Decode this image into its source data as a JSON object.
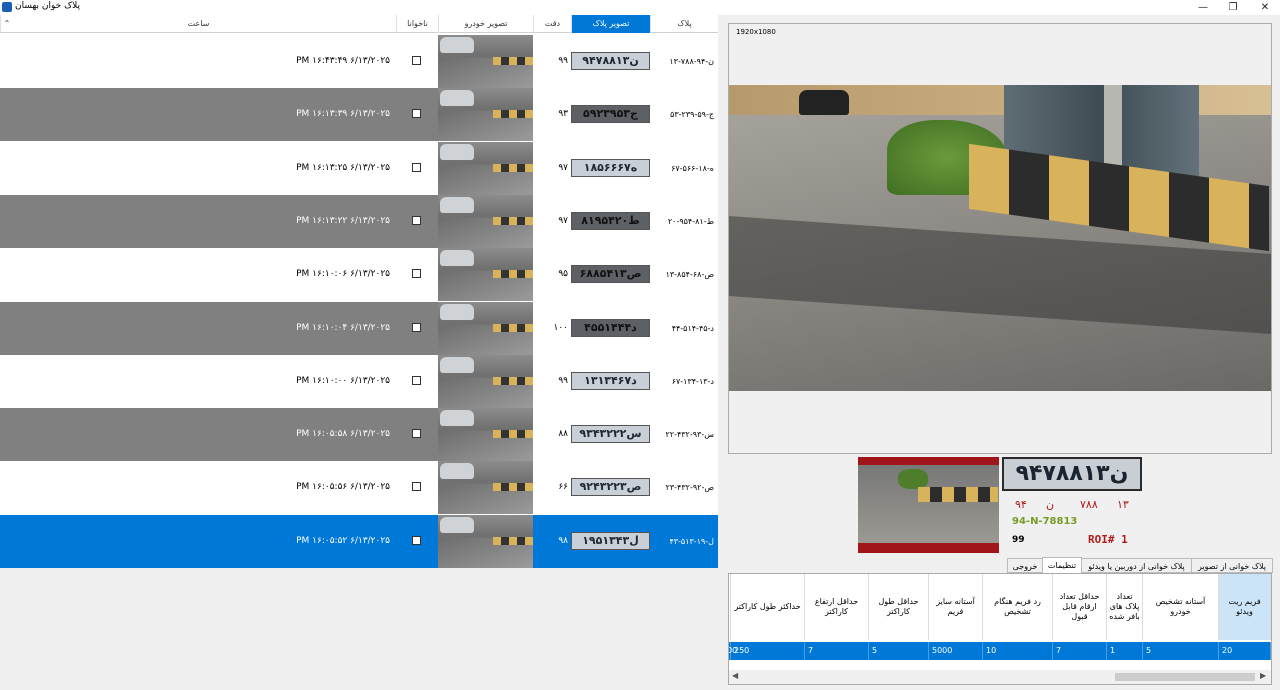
{
  "window": {
    "title": "پلاک خوان بهسان",
    "min": "—",
    "max": "❐",
    "close": "✕"
  },
  "grid": {
    "columns": [
      "پلاک",
      "تصویر پلاک",
      "دقت",
      "تصویر خودرو",
      "ناخوانا",
      "ساعت"
    ],
    "sort_marker": "⌃",
    "rows": [
      {
        "plate_text": "۱۳-۷۸۸-ن-۹۴",
        "plate_img": "۹۴ن۷۸۸۱۳",
        "accuracy": "۹۹",
        "time": "PM ۱۶:۴۳:۴۹ ۶/۱۳/۲۰۲۵",
        "style": "white"
      },
      {
        "plate_text": "۵۳-۲۳۹-ج-۵۹",
        "plate_img": "۵۹ج۲۳۹۵۳",
        "accuracy": "۹۳",
        "time": "PM ۱۶:۱۳:۳۹ ۶/۱۳/۲۰۲۵",
        "style": "gray"
      },
      {
        "plate_text": "۶۷-۵۶۶-ه-۱۸",
        "plate_img": "۱۸ه۵۶۶۶۷",
        "accuracy": "۹۷",
        "time": "PM ۱۶:۱۳:۲۵ ۶/۱۳/۲۰۲۵",
        "style": "white"
      },
      {
        "plate_text": "۲۰-۹۵۴-ط-۸۱",
        "plate_img": "۸۱ط۹۵۴۲۰",
        "accuracy": "۹۷",
        "time": "PM ۱۶:۱۳:۲۲ ۶/۱۳/۲۰۲۵",
        "style": "gray"
      },
      {
        "plate_text": "۱۳-۸۵۴-ص-۶۸",
        "plate_img": "۶۸ص۸۵۴۱۳",
        "accuracy": "۹۵",
        "time": "PM ۱۶:۱۰:۰۶ ۶/۱۳/۲۰۲۵",
        "style": "white"
      },
      {
        "plate_text": "۴۴-۵۱۴-د-۴۵",
        "plate_img": "۴۵د۵۱۴۴۴",
        "accuracy": "۱۰۰",
        "time": "PM ۱۶:۱۰:۰۴ ۶/۱۳/۲۰۲۵",
        "style": "gray"
      },
      {
        "plate_text": "۶۷-۱۳۴-د-۱۳",
        "plate_img": "۱۳د۱۳۴۶۷",
        "accuracy": "۹۹",
        "time": "PM ۱۶:۱۰:۰۰ ۶/۱۳/۲۰۲۵",
        "style": "white"
      },
      {
        "plate_text": "۲۲-۴۳۲-س-۹۳",
        "plate_img": "۹۳س۴۳۲۲۲",
        "accuracy": "۸۸",
        "time": "PM ۱۶:۰۵:۵۸ ۶/۱۳/۲۰۲۵",
        "style": "gray"
      },
      {
        "plate_text": "۲۳-۴۳۲-ص-۹۲",
        "plate_img": "۹۲ص۴۳۲۲۳",
        "accuracy": "۶۶",
        "time": "PM ۱۶:۰۵:۵۶ ۶/۱۳/۲۰۲۵",
        "style": "white"
      },
      {
        "plate_text": "۴۳-۵۱۳-ل-۱۹",
        "plate_img": "۱۹ل۵۱۳۴۳",
        "accuracy": "۹۸",
        "time": "PM ۱۶:۰۵:۵۲ ۶/۱۳/۲۰۲۵",
        "style": "sel"
      }
    ]
  },
  "preview": {
    "resolution": "1920x1080"
  },
  "detection": {
    "plate": "۹۴ن۷۸۸۱۳",
    "parts": [
      "۹۴",
      "ن",
      "۷۸۸",
      "۱۳"
    ],
    "latin": "94-N-78813",
    "score": "99",
    "roi": "ROI# 1"
  },
  "tabs": [
    "پلاک خوانی از تصویر",
    "پلاک خوانی از دوربین یا ویدئو",
    "تنظیمات",
    "خروجی"
  ],
  "settings": {
    "headers": [
      "فریم ریت ویدئو",
      "آستانه تشخیص خودرو",
      "تعداد پلاک های بافر شده",
      "حداقل تعداد ارقام قابل قبول",
      "رد فریم هنگام تشخیص",
      "آستانه سایز فریم",
      "حداقل طول کاراکتر",
      "حداقل ارتفاع کاراکتر",
      "حداکثر طول کاراکتر",
      "ح"
    ],
    "values": [
      "20",
      "5",
      "1",
      "7",
      "10",
      "5000",
      "5",
      "7",
      "250",
      "300"
    ]
  }
}
